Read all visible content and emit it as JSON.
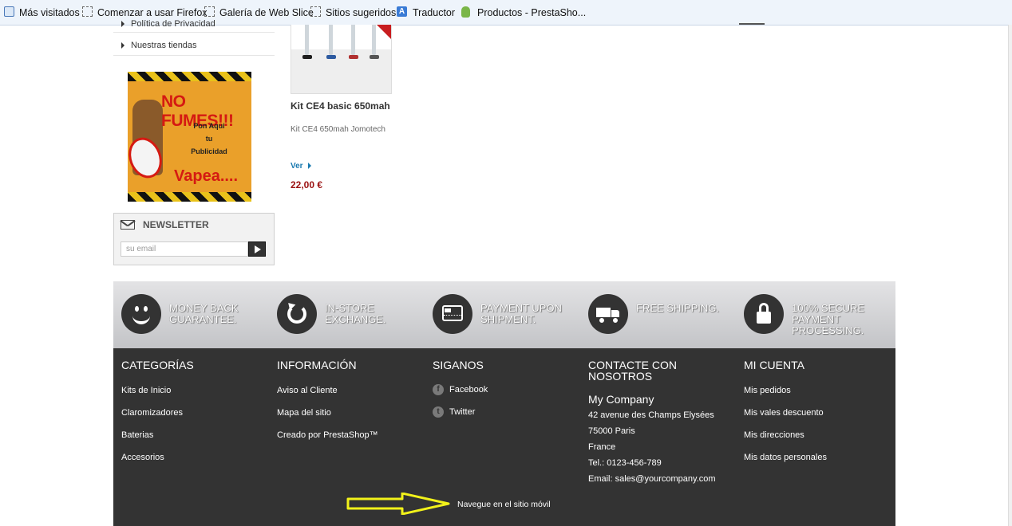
{
  "bookmarks": [
    {
      "label": "Más visitados",
      "icon": "magnifier-icon"
    },
    {
      "label": "Comenzar a usar Firefox",
      "icon": "page-dashed-icon"
    },
    {
      "label": "Galería de Web Slice",
      "icon": "page-dashed-icon"
    },
    {
      "label": "Sitios sugeridos",
      "icon": "page-dashed-icon"
    },
    {
      "label": "Traductor",
      "icon": "translate-icon"
    },
    {
      "label": "Productos - PrestaSho...",
      "icon": "prestashop-icon"
    }
  ],
  "sidebar": {
    "links": [
      "Política de Privacidad",
      "Nuestras tiendas"
    ],
    "ad": {
      "headline": "NO FUMES!!!",
      "line1": "Pon Aqui",
      "line2": "tu",
      "line3": "Publicidad",
      "tagline": "Vapea....",
      "sign_text": "NO SMOKING"
    },
    "newsletter": {
      "title": "NEWSLETTER",
      "placeholder": "su email"
    }
  },
  "product": {
    "name": "Kit CE4 basic 650mah",
    "description": "Kit CE4 650mah Jomotech",
    "more_label": "Ver",
    "price": "22,00 €"
  },
  "reassurance": [
    {
      "text": "MONEY BACK GUARANTEE.",
      "icon": "smile-icon"
    },
    {
      "text": "IN-STORE EXCHANGE.",
      "icon": "refresh-icon"
    },
    {
      "text": "PAYMENT UPON SHIPMENT.",
      "icon": "credit-card-icon"
    },
    {
      "text": "FREE SHIPPING.",
      "icon": "truck-icon"
    },
    {
      "text": "100% SECURE PAYMENT PROCESSING.",
      "icon": "lock-icon"
    }
  ],
  "footer": {
    "categories": {
      "title": "CATEGORÍAS",
      "items": [
        "Kits de Inicio",
        "Claromizadores",
        "Baterias",
        "Accesorios"
      ]
    },
    "info": {
      "title": "INFORMACIÓN",
      "items": [
        "Aviso al Cliente",
        "Mapa del sitio",
        "Creado por PrestaShop™"
      ]
    },
    "follow": {
      "title": "SIGANOS",
      "items": [
        {
          "label": "Facebook",
          "icon": "facebook-icon",
          "glyph": "f"
        },
        {
          "label": "Twitter",
          "icon": "twitter-icon",
          "glyph": "t"
        }
      ]
    },
    "contact": {
      "title_line1": "CONTACTE CON",
      "title_line2": "NOSOTROS",
      "company": "My Company",
      "lines": [
        "42 avenue des Champs Elysées",
        "75000 Paris",
        "France",
        "Tel.: 0123-456-789",
        "Email: sales@yourcompany.com"
      ]
    },
    "account": {
      "title": "MI CUENTA",
      "items": [
        "Mis pedidos",
        "Mis vales descuento",
        "Mis direcciones",
        "Mis datos personales"
      ]
    },
    "mobile_link": "Navegue en el sitio móvil"
  },
  "colors": {
    "footer_bg": "#333333",
    "price": "#9b1111",
    "link_blue": "#1a7ab0",
    "annotation_arrow": "#f2f21a"
  }
}
